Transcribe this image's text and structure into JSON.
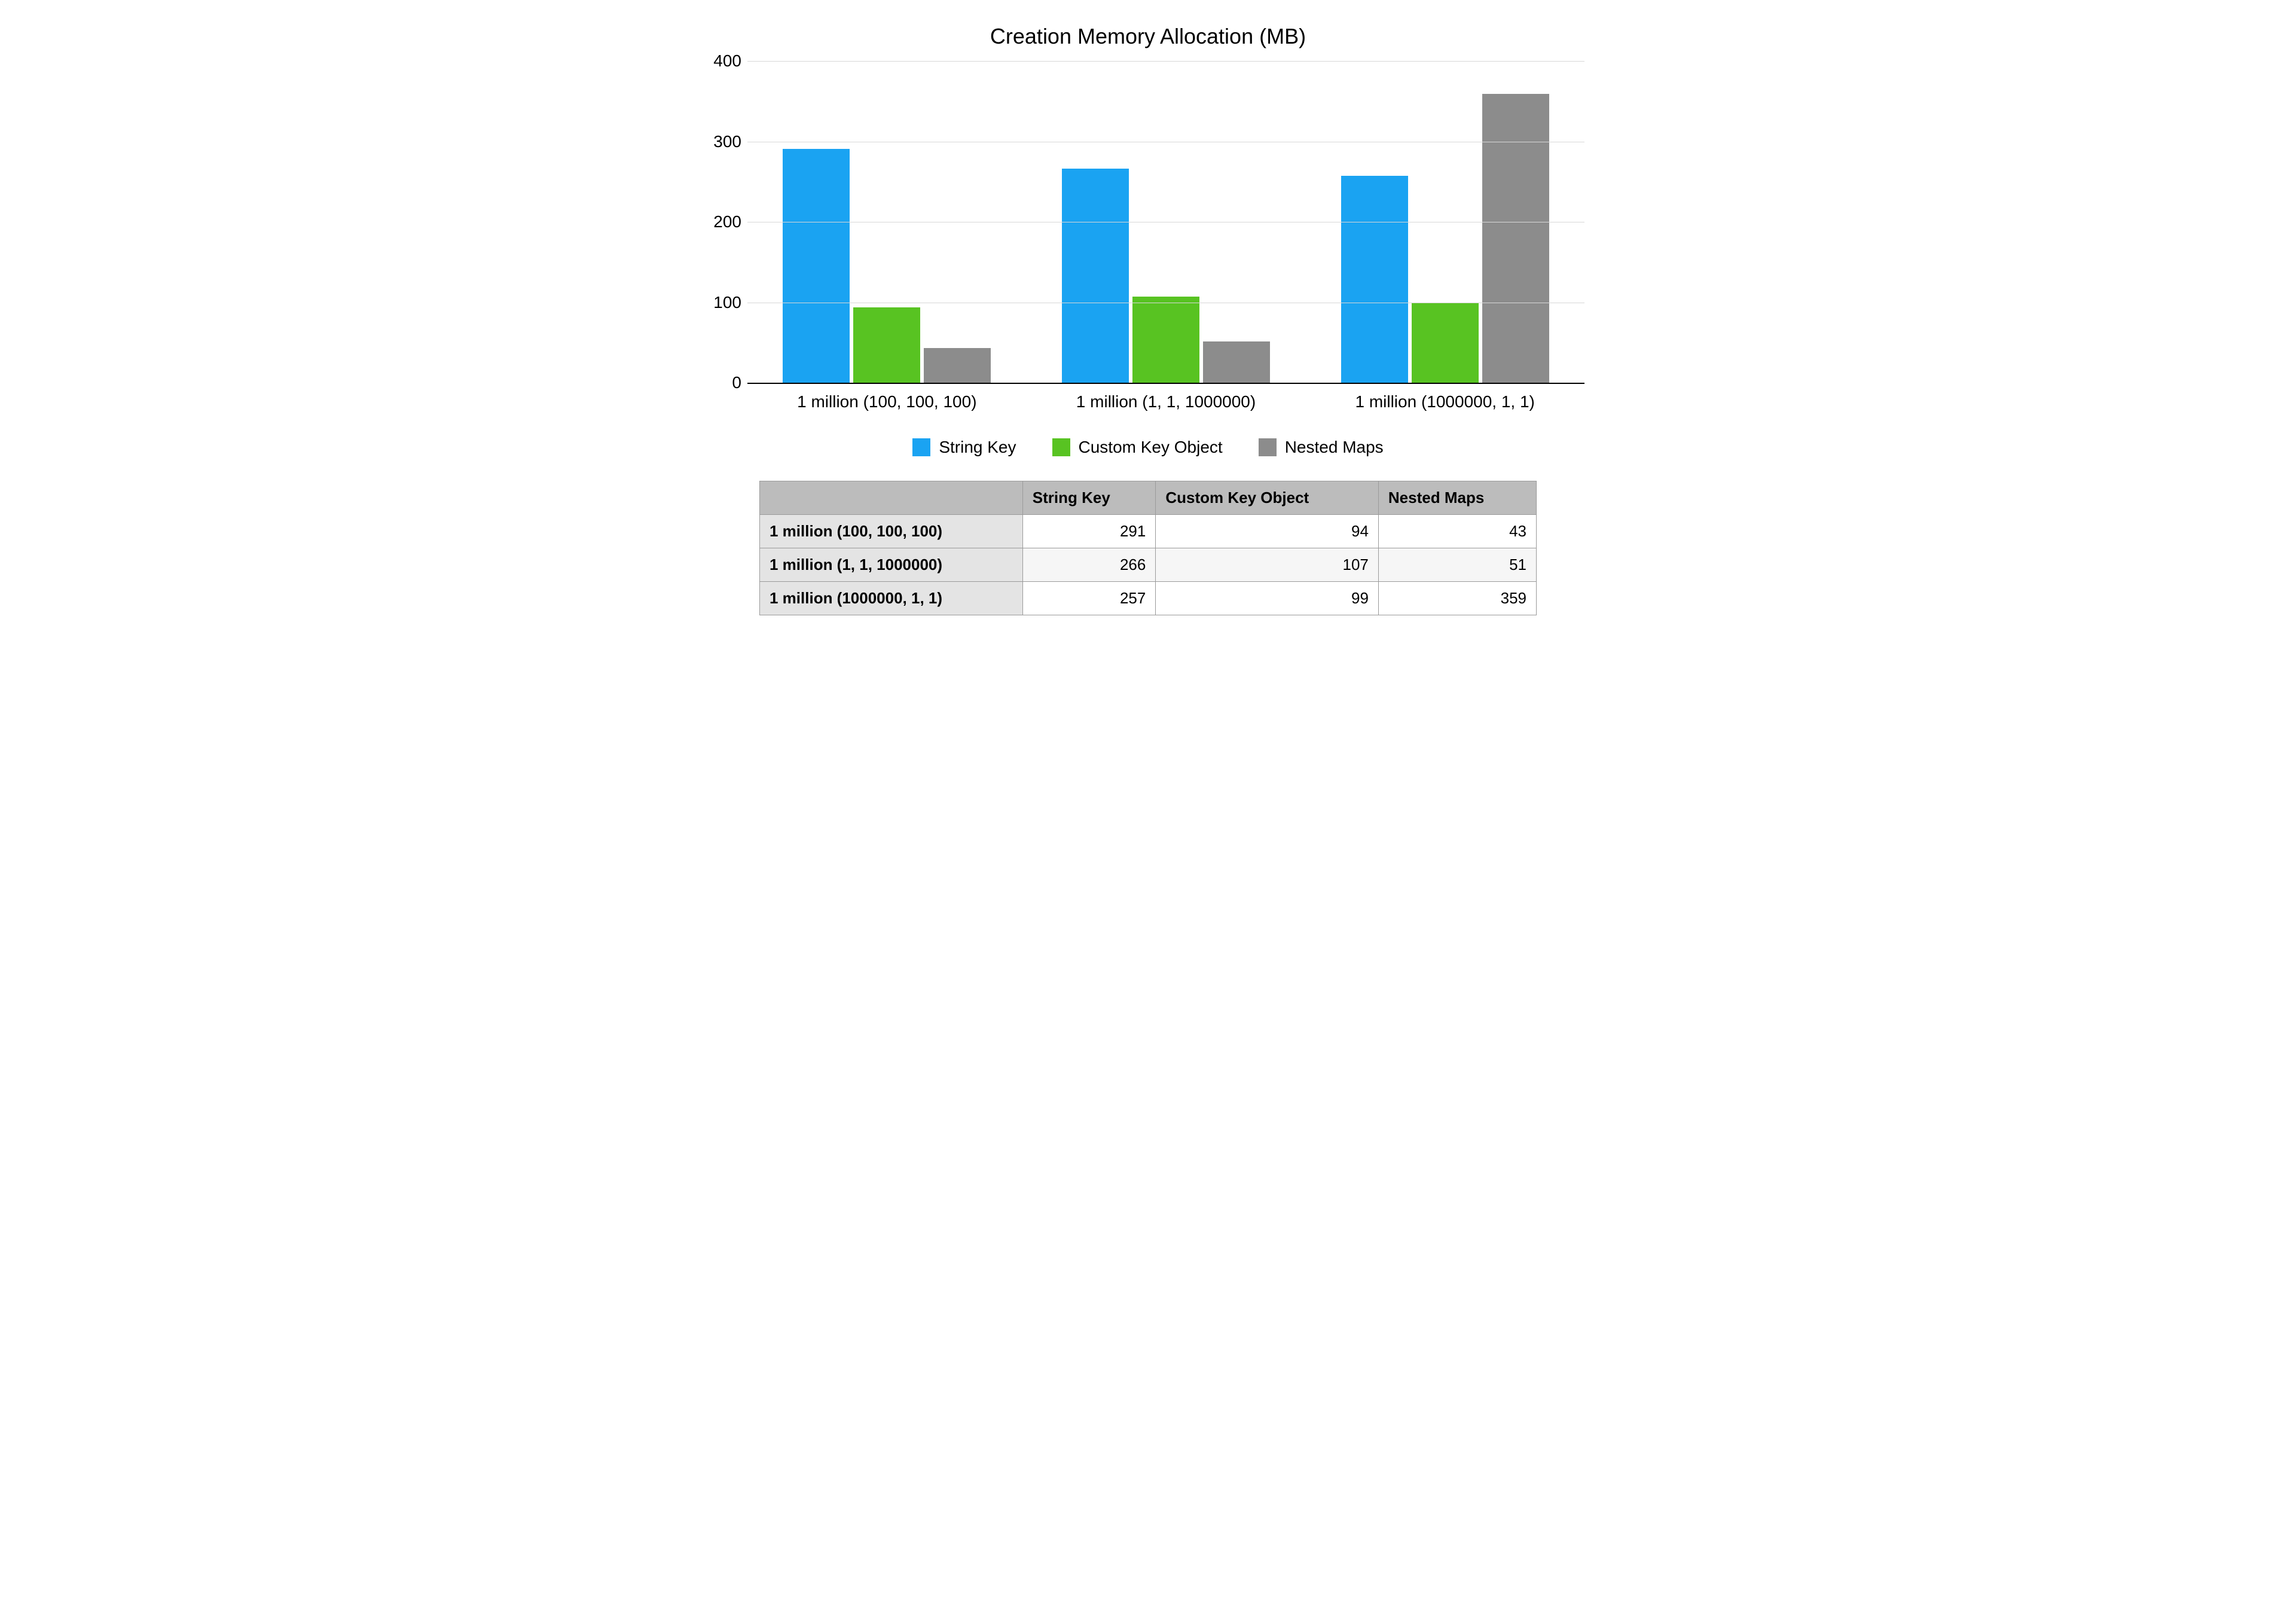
{
  "chart_data": {
    "type": "bar",
    "title": "Creation Memory Allocation (MB)",
    "categories": [
      "1 million (100, 100, 100)",
      "1 million (1, 1, 1000000)",
      "1 million (1000000, 1, 1)"
    ],
    "series": [
      {
        "name": "String Key",
        "color": "#1AA3F2",
        "values": [
          291,
          266,
          257
        ]
      },
      {
        "name": "Custom Key Object",
        "color": "#58C322",
        "values": [
          94,
          107,
          99
        ]
      },
      {
        "name": "Nested Maps",
        "color": "#8C8C8C",
        "values": [
          43,
          51,
          359
        ]
      }
    ],
    "ylim": [
      0,
      400
    ],
    "yticks": [
      0,
      100,
      200,
      300,
      400
    ],
    "xlabel": "",
    "ylabel": "",
    "grid": true,
    "legend_position": "bottom"
  }
}
